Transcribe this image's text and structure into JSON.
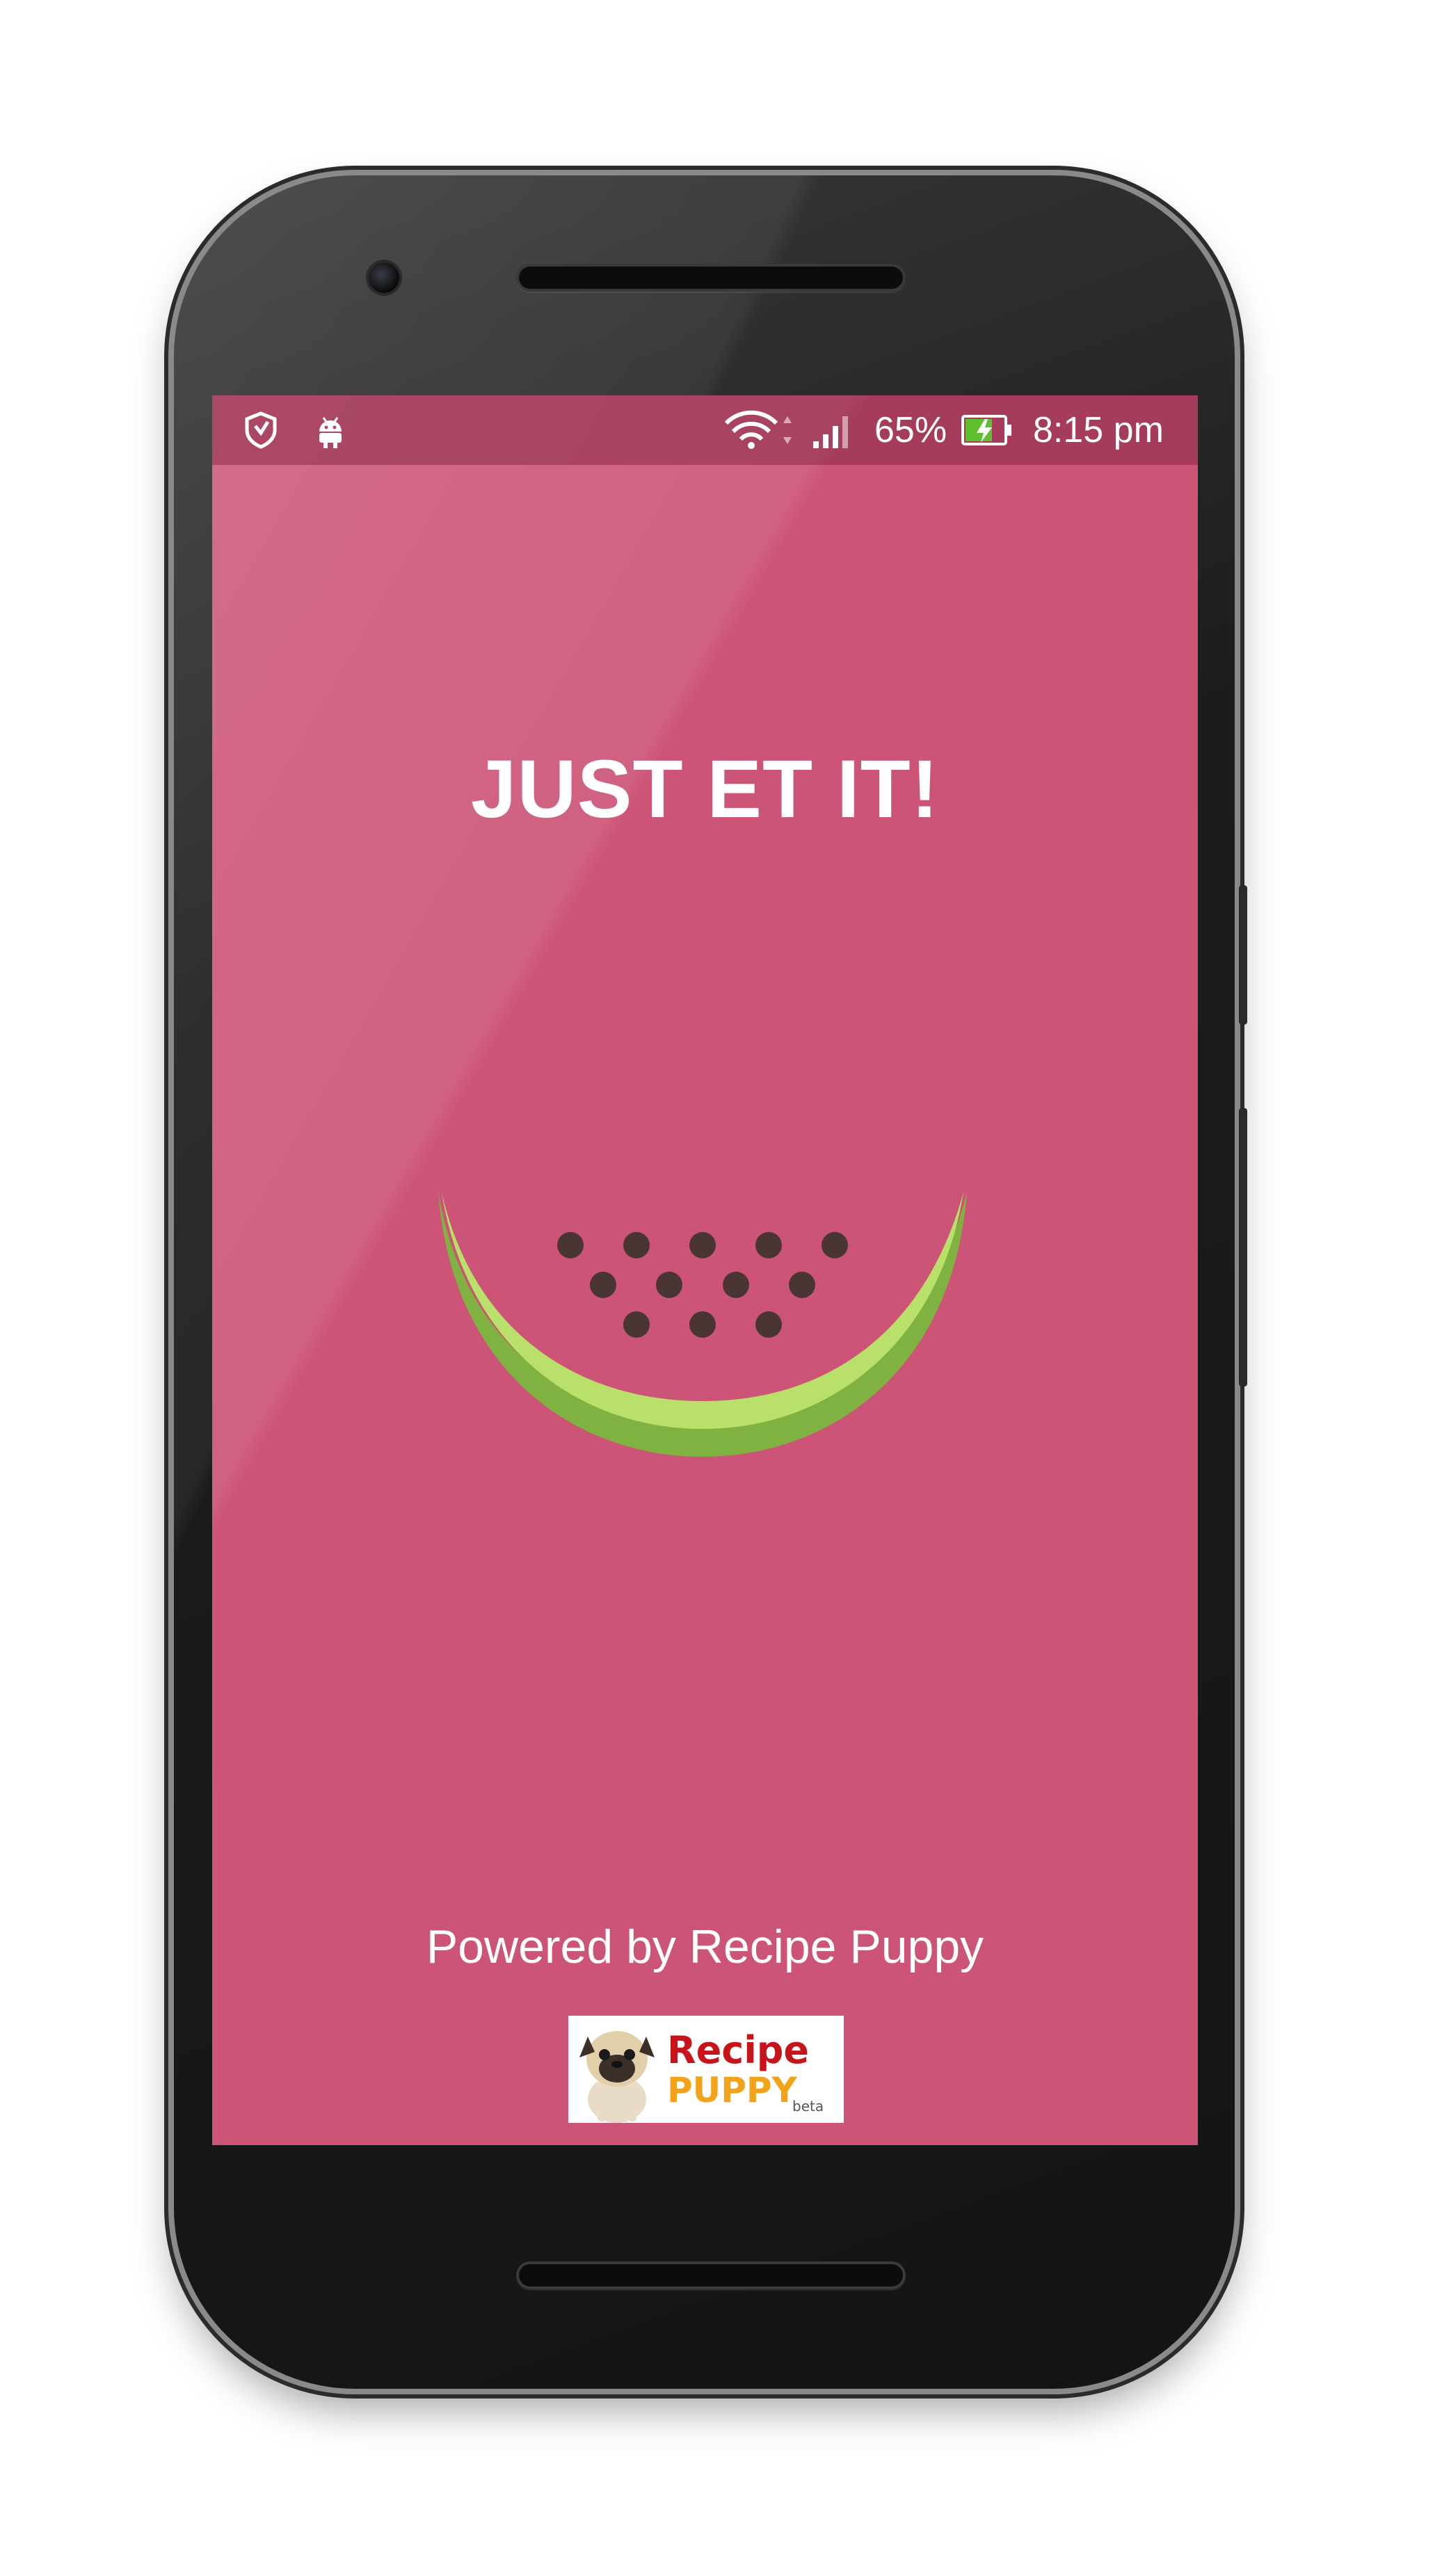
{
  "status_bar": {
    "battery_percent": "65%",
    "time": "8:15 pm",
    "icons": [
      "shield-icon",
      "android-icon",
      "wifi-icon",
      "signal-icon",
      "battery-charging-icon"
    ]
  },
  "splash": {
    "title": "JUST ET IT!",
    "powered_by": "Powered by Recipe Puppy",
    "logo": {
      "word1": "Recipe",
      "word2": "PUPPY",
      "tag": "beta"
    }
  },
  "colors": {
    "background": "#cc5476",
    "rind_light": "#b9e06a",
    "rind_dark": "#7fb241",
    "seed": "#4a3535",
    "logo_red": "#c7141b",
    "logo_yellow": "#f2a31a"
  }
}
